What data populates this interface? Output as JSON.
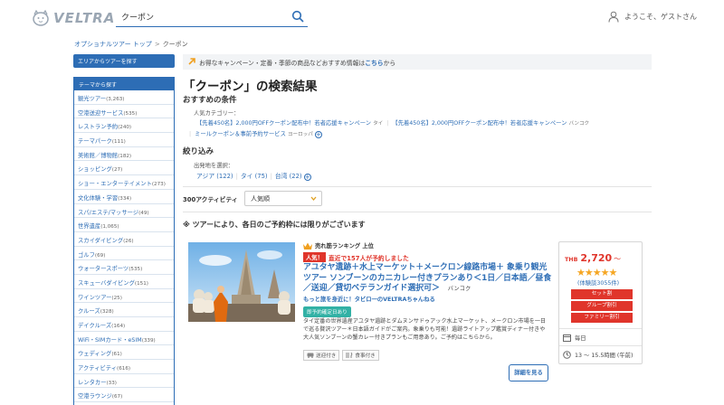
{
  "header": {
    "logo_text": "VELTRA",
    "search_value": "クーポン",
    "user_greeting": "ようこそ、ゲストさん"
  },
  "breadcrumb": {
    "home": "オプショナルツアー トップ",
    "separator": ">",
    "current": "クーポン"
  },
  "sidebar": {
    "area_button": "エリアからツアーを探す",
    "theme_header": "テーマから探す",
    "themes": [
      {
        "label": "観光ツアー",
        "count": "(3,263)"
      },
      {
        "label": "空港送迎サービス",
        "count": "(535)"
      },
      {
        "label": "レストラン予約",
        "count": "(240)"
      },
      {
        "label": "テーマパーク",
        "count": "(111)"
      },
      {
        "label": "美術館／博物館",
        "count": "(182)"
      },
      {
        "label": "ショッピング",
        "count": "(27)"
      },
      {
        "label": "ショー・エンターテイメント",
        "count": "(273)"
      },
      {
        "label": "文化体験・学習",
        "count": "(334)"
      },
      {
        "label": "スパ/エステ/マッサージ",
        "count": "(49)"
      },
      {
        "label": "世界遺産",
        "count": "(1,065)"
      },
      {
        "label": "スカイダイビング",
        "count": "(26)"
      },
      {
        "label": "ゴルフ",
        "count": "(69)"
      },
      {
        "label": "ウォータースポーツ",
        "count": "(535)"
      },
      {
        "label": "スキューバダイビング",
        "count": "(151)"
      },
      {
        "label": "ワインツアー",
        "count": "(25)"
      },
      {
        "label": "クルーズ",
        "count": "(328)"
      },
      {
        "label": "デイクルーズ",
        "count": "(164)"
      },
      {
        "label": "WiFi・SIMカード・eSIM",
        "count": "(339)"
      },
      {
        "label": "ウェディング",
        "count": "(61)"
      },
      {
        "label": "アクティビティ",
        "count": "(616)"
      },
      {
        "label": "レンタカー",
        "count": "(33)"
      },
      {
        "label": "空港ラウンジ",
        "count": "(67)"
      }
    ]
  },
  "campaign": {
    "text": "お得なキャンペーン・定番・季節の商品などおすすめ情報は",
    "link": "こちら",
    "suffix": "から"
  },
  "results": {
    "title": "「クーポン」の検索結果",
    "recommended_title": "おすすめの条件",
    "popular_category_label": "人気カテゴリー：",
    "popular_links": [
      {
        "label": "【先着450名】2,000円OFFクーポン配布中！若者応援キャンペーン",
        "sub": "タイ"
      },
      {
        "label": "【先着450名】2,000円OFFクーポン配布中！若者応援キャンペーン",
        "sub": "バンコク"
      },
      {
        "label": "ミールクーポン＆事前予約サービス",
        "sub": "ヨーロッパ"
      }
    ],
    "filter_title": "絞り込み",
    "departure_label": "出発地を選択：",
    "departures": [
      "アジア (122)",
      "タイ (75)",
      "台湾 (22)"
    ],
    "count_text": "300アクティビティ",
    "sort_value": "人気順",
    "notice": "※ ツアーにより、各日のご予約枠には限りがございます"
  },
  "tour": {
    "ranking": "売れ筋ランキング 上位",
    "popular_badge": "人気！",
    "popular_text": "直近で157人が予約しました",
    "title": "アユタヤ遺跡＋水上マーケット＋メークロン線路市場＋ 象乗り観光ツアー ソンブーンのカニカレー付きプランあり＜1日／日本語／昼食／送迎／貸切ベテランガイド選択可＞",
    "location": "バンコク",
    "subtitle": "もっと旅を身近に！タビロ一のVELTRAちゃんねる",
    "confirm_badge": "即予約確定日あり",
    "description": "タイ定番の世界遺産アユタヤ遺跡とダムヌンサドゥアック水上マーケット、メークロン市場を一日で巡る贅沢ツアー＊日本語ガイドがご案内。象乗りも可能！遺跡ライトアップ鑑賞ディナー付きや大人気ソンブーンの蟹カレー付きプランもご用意あり。ご予約はこちらから。",
    "tags": [
      "送迎付き",
      "食事付き"
    ],
    "detail_button": "詳細を見る",
    "price_currency": "THB",
    "price": "2,720",
    "price_suffix": "〜",
    "rating": 4.5,
    "stars": "★★★★★",
    "reviews": "(体験談3055件)",
    "badges": [
      "セット割",
      "グループ割引",
      "ファミリー割引"
    ],
    "schedule": "毎日",
    "duration": "13 〜 15.5時間 (午前)"
  },
  "colors": {
    "brand_blue": "#2d6db5",
    "sale_red": "#e0352b",
    "teal": "#32b1a5",
    "star": "#f5a623"
  }
}
